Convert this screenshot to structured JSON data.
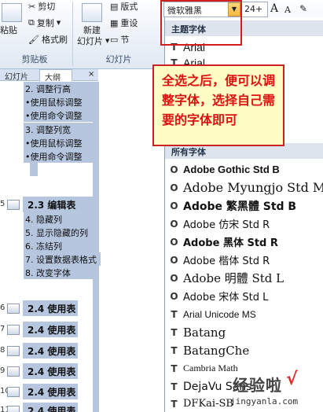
{
  "ribbon": {
    "clipboard": {
      "paste": "粘贴",
      "cut": "剪切",
      "copy": "复制",
      "format_painter": "格式刷",
      "group": "剪贴板"
    },
    "slides": {
      "new_slide_line1": "新建",
      "new_slide_line2": "幻灯片",
      "layout": "版式",
      "reset": "重设",
      "section": "节",
      "group": "幻灯片"
    },
    "font": {
      "name": "微软雅黑",
      "size": "24+",
      "grow": "A",
      "shrink": "A",
      "clear": "✎"
    }
  },
  "font_dropdown": {
    "theme_header": "主题字体",
    "theme_fonts": [
      "Arial",
      "Arial"
    ],
    "all_header": "所有字体",
    "fonts": [
      {
        "label": "Adobe Gothic Std B",
        "icon": "O"
      },
      {
        "label": "Adobe Myungjo Std M",
        "icon": "O"
      },
      {
        "label": "Adobe 繁黑體 Std B",
        "icon": "O"
      },
      {
        "label": "Adobe 仿宋 Std R",
        "icon": "O"
      },
      {
        "label": "Adobe 黑体 Std R",
        "icon": "O"
      },
      {
        "label": "Adobe 楷体 Std R",
        "icon": "O"
      },
      {
        "label": "Adobe 明體 Std L",
        "icon": "O"
      },
      {
        "label": "Adobe 宋体 Std L",
        "icon": "O"
      },
      {
        "label": "Arial Unicode MS",
        "icon": "T"
      },
      {
        "label": "Batang",
        "icon": "T"
      },
      {
        "label": "BatangChe",
        "icon": "T"
      },
      {
        "label": "Cambria Math",
        "icon": "T"
      },
      {
        "label": "DejaVu Sans",
        "icon": "T"
      },
      {
        "label": "DFKai-SB",
        "icon": "T"
      }
    ]
  },
  "callout": {
    "text": "全选之后，便可以调整字体，选择自己需要的字体即可"
  },
  "left_panel": {
    "tabs": {
      "slides": "幻灯片",
      "outline": "大纲"
    },
    "lines": [
      "2. 调整行高",
      "•使用鼠标调整",
      "•使用命令调整",
      "3. 调整列宽",
      "•使用鼠标调整",
      "•使用命令调整"
    ],
    "section": {
      "title": "2.3 编辑表",
      "items": [
        "4. 隐藏列",
        "5. 显示隐藏的列",
        "6. 冻结列",
        "7. 设置数据表格式",
        "8. 改变字体"
      ]
    },
    "slide_titles": [
      "2.4 使用表",
      "2.4 使用表",
      "2.4 使用表",
      "2.4 使用表",
      "2.4 使用表",
      "2.4 使用表"
    ],
    "slide_numbers": [
      "6",
      "7",
      "8",
      "9",
      "10",
      "11"
    ]
  },
  "watermark": {
    "brand": "经验啦",
    "check": "√",
    "url": "jingyanla.com"
  }
}
